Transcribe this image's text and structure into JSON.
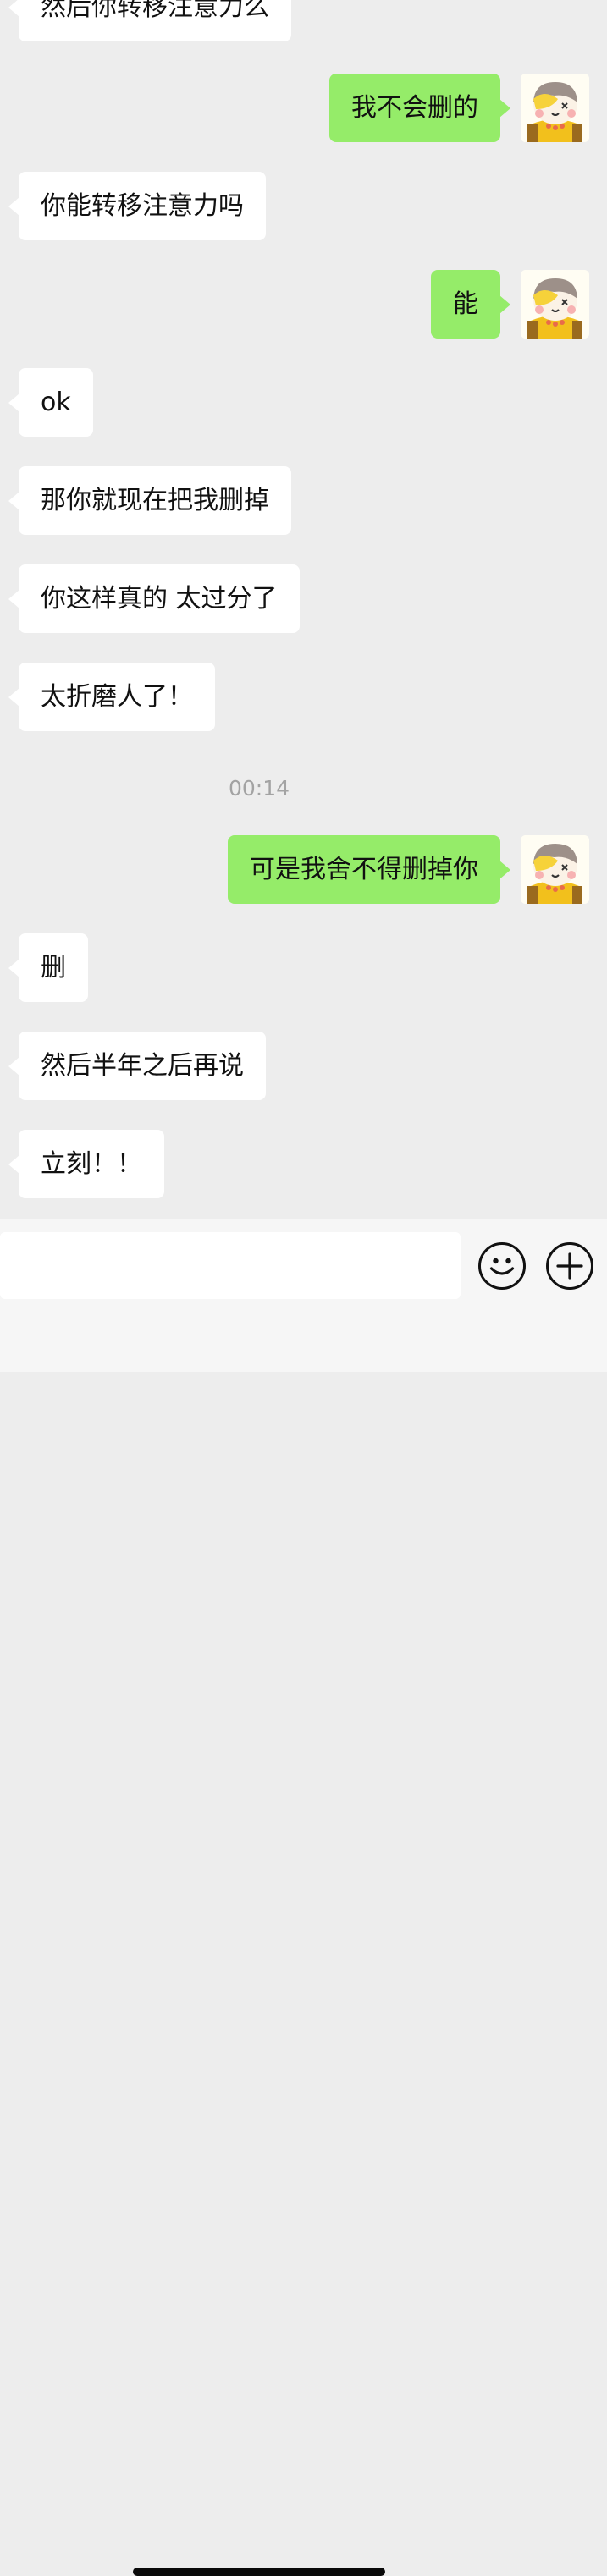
{
  "chat": {
    "partial_top": "然后你转移注意力么",
    "m1": "我不会删的",
    "m2": "你能转移注意力吗",
    "m3": "能",
    "m4": "ok",
    "m5": "那你就现在把我删掉",
    "m6": "你这样真的 太过分了",
    "m7": "太折磨人了！",
    "timestamp": "00:14",
    "m8": "可是我舍不得删掉你",
    "m9": "删",
    "m10": "然后半年之后再说",
    "m11": "立刻！！"
  },
  "input_bar": {
    "text_value": "",
    "emoji_icon": "smiley-icon",
    "plus_icon": "plus-circle-icon"
  },
  "colors": {
    "background": "#ededed",
    "incoming_bubble": "#ffffff",
    "outgoing_bubble": "#95ec69",
    "timestamp_text": "#a3a3a3"
  }
}
